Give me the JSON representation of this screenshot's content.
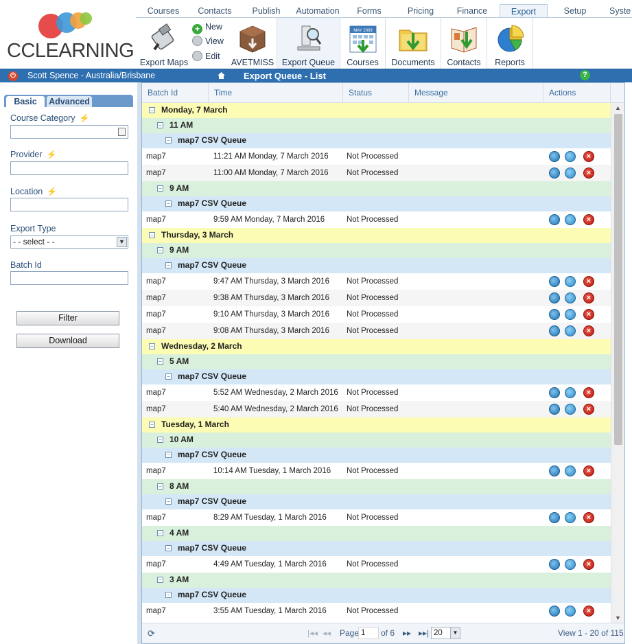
{
  "logo": {
    "text": "CCLEARNING"
  },
  "nav": {
    "tabs": [
      "Courses",
      "Contacts",
      "Publish",
      "Automation",
      "Forms",
      "Pricing",
      "Finance",
      "Export",
      "Setup",
      "Syste"
    ],
    "active": "Export"
  },
  "toolbar": {
    "export_maps": "Export Maps",
    "new": "New",
    "view": "View",
    "edit": "Edit",
    "avetmiss": "AVETMISS",
    "export_queue": "Export Queue",
    "courses": "Courses",
    "courses_banner": "MAY 2009",
    "documents": "Documents",
    "contacts": "Contacts",
    "reports": "Reports"
  },
  "userbar": {
    "user": "Scott Spence - Australia/Brisbane",
    "title": "Export Queue - List",
    "help": "?"
  },
  "sidebar": {
    "tab_basic": "Basic",
    "tab_advanced": "Advanced",
    "course_category": "Course Category",
    "provider": "Provider",
    "location": "Location",
    "export_type": "Export Type",
    "export_type_value": "- - select - -",
    "batch_id": "Batch Id",
    "filter": "Filter",
    "download": "Download"
  },
  "grid": {
    "columns": [
      "Batch Id",
      "Time",
      "Status",
      "Message",
      "Actions"
    ],
    "groups": [
      {
        "day": "Monday, 7 March",
        "hours": [
          {
            "hour": "11 AM",
            "queue": "map7 CSV Queue",
            "rows": [
              {
                "batch": "map7",
                "time": "11:21 AM Monday, 7 March 2016",
                "status": "Not Processed"
              },
              {
                "batch": "map7",
                "time": "11:00 AM Monday, 7 March 2016",
                "status": "Not Processed"
              }
            ]
          },
          {
            "hour": "9 AM",
            "queue": "map7 CSV Queue",
            "rows": [
              {
                "batch": "map7",
                "time": "9:59 AM Monday, 7 March 2016",
                "status": "Not Processed"
              }
            ]
          }
        ]
      },
      {
        "day": "Thursday, 3 March",
        "hours": [
          {
            "hour": "9 AM",
            "queue": "map7 CSV Queue",
            "rows": [
              {
                "batch": "map7",
                "time": "9:47 AM Thursday, 3 March 2016",
                "status": "Not Processed"
              },
              {
                "batch": "map7",
                "time": "9:38 AM Thursday, 3 March 2016",
                "status": "Not Processed"
              },
              {
                "batch": "map7",
                "time": "9:10 AM Thursday, 3 March 2016",
                "status": "Not Processed"
              },
              {
                "batch": "map7",
                "time": "9:08 AM Thursday, 3 March 2016",
                "status": "Not Processed"
              }
            ]
          }
        ]
      },
      {
        "day": "Wednesday, 2 March",
        "hours": [
          {
            "hour": "5 AM",
            "queue": "map7 CSV Queue",
            "rows": [
              {
                "batch": "map7",
                "time": "5:52 AM Wednesday, 2 March 2016",
                "status": "Not Processed"
              },
              {
                "batch": "map7",
                "time": "5:40 AM Wednesday, 2 March 2016",
                "status": "Not Processed"
              }
            ]
          }
        ]
      },
      {
        "day": "Tuesday, 1 March",
        "hours": [
          {
            "hour": "10 AM",
            "queue": "map7 CSV Queue",
            "rows": [
              {
                "batch": "map7",
                "time": "10:14 AM Tuesday, 1 March 2016",
                "status": "Not Processed"
              }
            ]
          },
          {
            "hour": "8 AM",
            "queue": "map7 CSV Queue",
            "rows": [
              {
                "batch": "map7",
                "time": "8:29 AM Tuesday, 1 March 2016",
                "status": "Not Processed"
              }
            ]
          },
          {
            "hour": "4 AM",
            "queue": "map7 CSV Queue",
            "rows": [
              {
                "batch": "map7",
                "time": "4:49 AM Tuesday, 1 March 2016",
                "status": "Not Processed"
              }
            ]
          },
          {
            "hour": "3 AM",
            "queue": "map7 CSV Queue",
            "rows": [
              {
                "batch": "map7",
                "time": "3:55 AM Tuesday, 1 March 2016",
                "status": "Not Processed"
              }
            ]
          }
        ]
      }
    ]
  },
  "pager": {
    "page_label": "Page",
    "page_value": "1",
    "of_label": "of 6",
    "page_size": "20",
    "summary": "View 1 - 20 of 115"
  },
  "colors": {
    "accent": "#2e6fb0",
    "day_row": "#fcfcb4",
    "hour_row": "#d9f0dc",
    "queue_row": "#d3e7f6"
  }
}
